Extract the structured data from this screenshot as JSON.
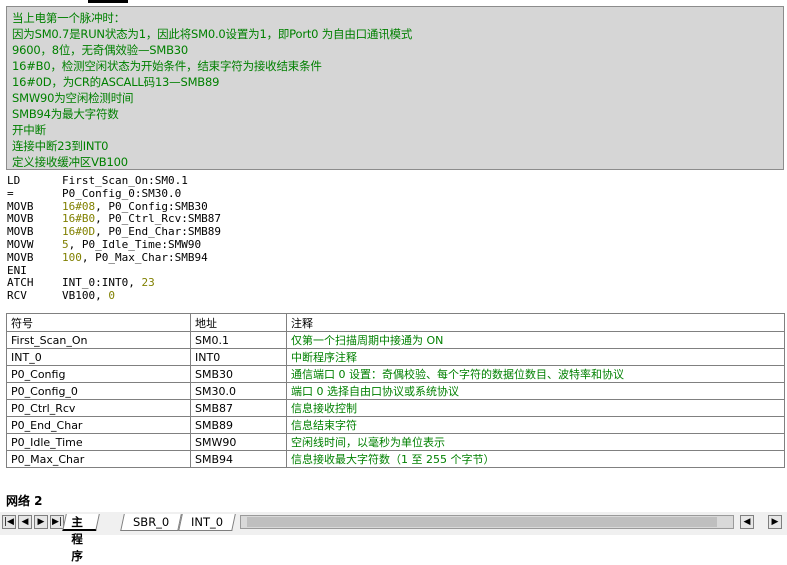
{
  "comment": {
    "lines": [
      "当上电第一个脉冲时：",
      "因为SM0.7是RUN状态为1，因此将SM0.0设置为1，即Port0 为自由口通讯模式",
      "9600，8位，无奇偶效验—SMB30",
      "16#B0，检测空闲状态为开始条件，结束字符为接收结束条件",
      "16#0D，为CR的ASCALL码13—SMB89",
      "SMW90为空闲检测时间",
      "SMB94为最大字符数",
      "开中断",
      "连接中断23到INT0",
      "定义接收缓冲区VB100"
    ]
  },
  "code": [
    {
      "op": "LD",
      "parts": [
        {
          "t": "First_Scan_On:SM0.1",
          "c": "txt"
        }
      ]
    },
    {
      "op": "=",
      "parts": [
        {
          "t": "P0_Config_0:SM30.0",
          "c": "txt"
        }
      ]
    },
    {
      "op": "MOVB",
      "parts": [
        {
          "t": "16#08",
          "c": "num"
        },
        {
          "t": ", P0_Config:SMB30",
          "c": "txt"
        }
      ]
    },
    {
      "op": "MOVB",
      "parts": [
        {
          "t": "16#B0",
          "c": "num"
        },
        {
          "t": ", P0_Ctrl_Rcv:SMB87",
          "c": "txt"
        }
      ]
    },
    {
      "op": "MOVB",
      "parts": [
        {
          "t": "16#0D",
          "c": "num"
        },
        {
          "t": ", P0_End_Char:SMB89",
          "c": "txt"
        }
      ]
    },
    {
      "op": "MOVW",
      "parts": [
        {
          "t": "5",
          "c": "num"
        },
        {
          "t": ", P0_Idle_Time:SMW90",
          "c": "txt"
        }
      ]
    },
    {
      "op": "MOVB",
      "parts": [
        {
          "t": "100",
          "c": "num"
        },
        {
          "t": ", P0_Max_Char:SMB94",
          "c": "txt"
        }
      ]
    },
    {
      "op": "ENI",
      "parts": []
    },
    {
      "op": "ATCH",
      "parts": [
        {
          "t": "INT_0:INT0, ",
          "c": "txt"
        },
        {
          "t": "23",
          "c": "num"
        }
      ]
    },
    {
      "op": "RCV",
      "parts": [
        {
          "t": "VB100, ",
          "c": "txt"
        },
        {
          "t": "0",
          "c": "num"
        }
      ]
    }
  ],
  "symbol_table": {
    "headers": [
      "符号",
      "地址",
      "注释"
    ],
    "rows": [
      [
        "First_Scan_On",
        "SM0.1",
        "仅第一个扫描周期中接通为 ON"
      ],
      [
        "INT_0",
        "INT0",
        "中断程序注释"
      ],
      [
        "P0_Config",
        "SMB30",
        "通信端口 0 设置：奇偶校验、每个字符的数据位数目、波特率和协议"
      ],
      [
        "P0_Config_0",
        "SM30.0",
        "端口 0 选择自由口协议或系统协议"
      ],
      [
        "P0_Ctrl_Rcv",
        "SMB87",
        "信息接收控制"
      ],
      [
        "P0_End_Char",
        "SMB89",
        "信息结束字符"
      ],
      [
        "P0_Idle_Time",
        "SMW90",
        "空闲线时间，以毫秒为单位表示"
      ],
      [
        "P0_Max_Char",
        "SMB94",
        "信息接收最大字符数（1 至 255 个字节）"
      ]
    ]
  },
  "network_label": "网络 2",
  "tabs": [
    "主程序",
    "SBR_0",
    "INT_0"
  ],
  "nav": {
    "first": "|◀",
    "prev": "◀",
    "next": "▶",
    "last": "▶|",
    "scroll_left": "◀",
    "scroll_right": "▶"
  },
  "colors": {
    "comment_green": "#008000",
    "constant_olive": "#808000",
    "comment_bg": "#d6d6d6"
  }
}
